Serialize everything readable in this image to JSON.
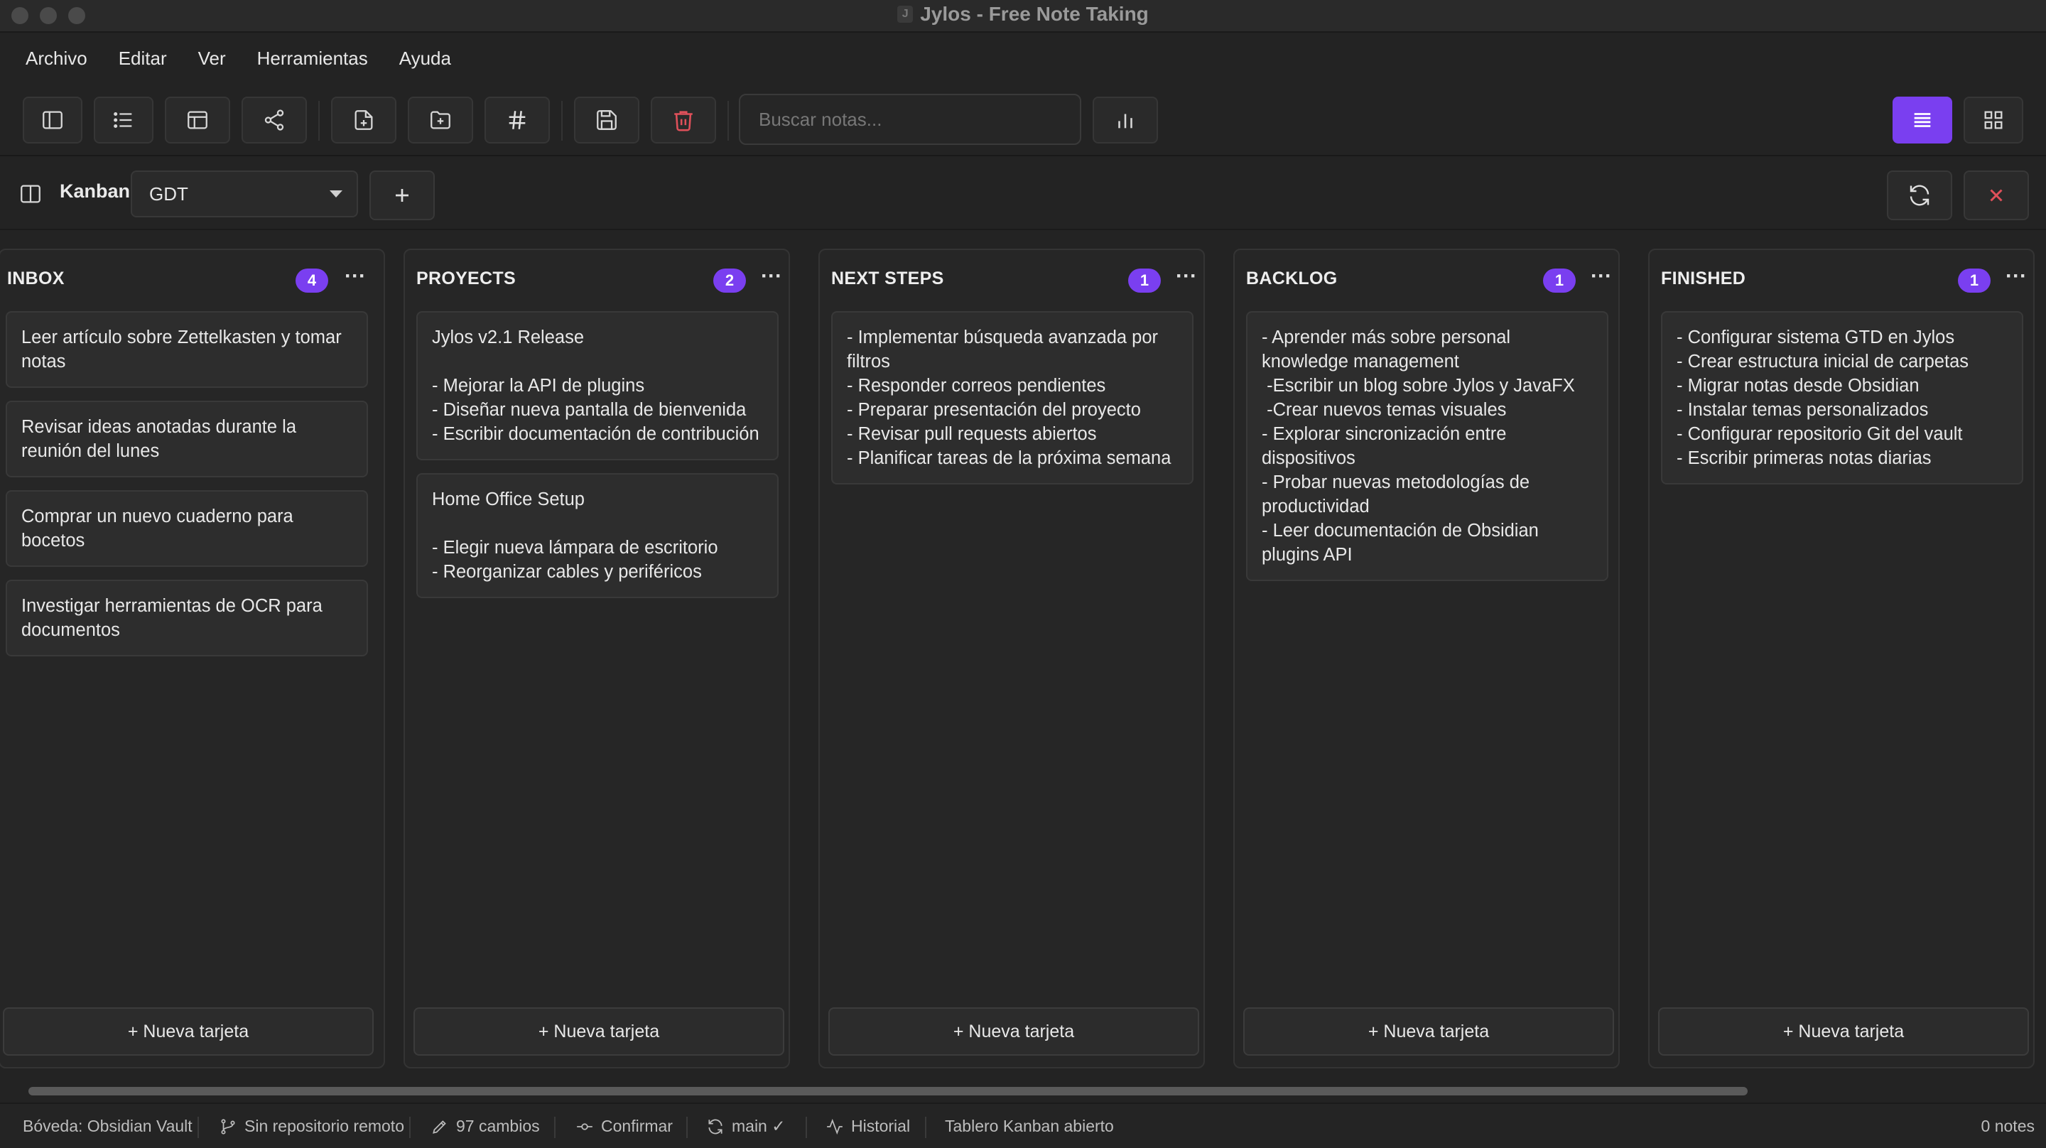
{
  "window": {
    "title": "Jylos - Free Note Taking"
  },
  "menu": [
    "Archivo",
    "Editar",
    "Ver",
    "Herramientas",
    "Ayuda"
  ],
  "toolbar": {
    "buttons": [
      "sidebar-toggle-icon",
      "list-icon",
      "layout-icon",
      "share-icon",
      "new-note-icon",
      "new-folder-icon",
      "hashtag-icon",
      "save-icon",
      "trash-icon",
      "stats-icon",
      "list-view-icon",
      "grid-view-icon"
    ],
    "search_placeholder": "Buscar notas...",
    "accent": "#7a3ff0",
    "danger": "#e0505a"
  },
  "kanban": {
    "label": "Kanban",
    "board_selected": "GDT",
    "new_card_label": "+ Nueva tarjeta",
    "columns": [
      {
        "title": "INBOX",
        "count": "4",
        "cards": [
          "Leer artículo sobre Zettelkasten y tomar notas",
          "Revisar ideas anotadas durante la reunión del lunes",
          "Comprar un nuevo cuaderno para bocetos",
          "Investigar herramientas de OCR para documentos"
        ]
      },
      {
        "title": "PROYECTS",
        "count": "2",
        "cards": [
          "Jylos v2.1 Release\n\n- Mejorar la API de plugins\n- Diseñar nueva pantalla de bienvenida\n- Escribir documentación de contribución",
          "Home Office Setup\n\n- Elegir nueva lámpara de escritorio\n- Reorganizar cables y periféricos"
        ]
      },
      {
        "title": "NEXT STEPS",
        "count": "1",
        "cards": [
          "- Implementar búsqueda avanzada por filtros\n- Responder correos pendientes\n- Preparar presentación del proyecto\n- Revisar pull requests abiertos\n- Planificar tareas de la próxima semana"
        ]
      },
      {
        "title": "BACKLOG",
        "count": "1",
        "cards": [
          "- Aprender más sobre personal knowledge management\n -Escribir un blog sobre Jylos y JavaFX\n -Crear nuevos temas visuales\n- Explorar sincronización entre dispositivos\n- Probar nuevas metodologías de productividad\n- Leer documentación de Obsidian plugins API"
        ]
      },
      {
        "title": "FINISHED",
        "count": "1",
        "cards": [
          "- Configurar sistema GTD en Jylos\n- Crear estructura inicial de carpetas\n- Migrar notas desde Obsidian\n- Instalar temas personalizados\n- Configurar repositorio Git del vault\n- Escribir primeras notas diarias"
        ]
      }
    ]
  },
  "status": {
    "vault": "Bóveda: Obsidian Vault",
    "remote": "Sin repositorio remoto",
    "changes": "97 cambios",
    "commit": "Confirmar",
    "branch": "main ✓",
    "history": "Historial",
    "message": "Tablero Kanban abierto",
    "notes": "0 notes"
  }
}
